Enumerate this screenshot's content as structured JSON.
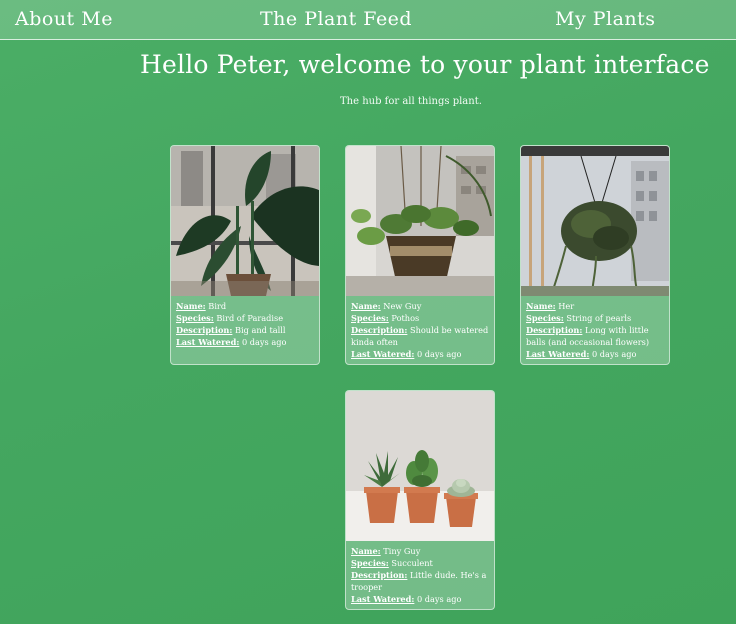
{
  "nav": {
    "about": "About Me",
    "feed": "The Plant Feed",
    "plants": "My Plants"
  },
  "header": {
    "title": "Hello Peter, welcome to your plant interface",
    "subtitle": "The hub for all things plant."
  },
  "labels": {
    "name": "Name:",
    "species": "Species:",
    "description": "Description:",
    "last_watered": "Last Watered:"
  },
  "plants": [
    {
      "name": "Bird",
      "species": "Bird of Paradise",
      "description": "Big and talll",
      "last_watered": "0 days ago"
    },
    {
      "name": "New Guy",
      "species": "Pothos",
      "description": "Should be watered kinda often",
      "last_watered": "0 days ago"
    },
    {
      "name": "Her",
      "species": "String of pearls",
      "description": "Long with little balls (and occasional flowers)",
      "last_watered": "0 days ago"
    },
    {
      "name": "Tiny Guy",
      "species": "Succulent",
      "description": "Little dude. He's a trooper",
      "last_watered": "0 days ago"
    }
  ],
  "colors": {
    "background": "#44a760",
    "card": "rgba(255,255,255,0.27)",
    "text": "#ffffff"
  }
}
